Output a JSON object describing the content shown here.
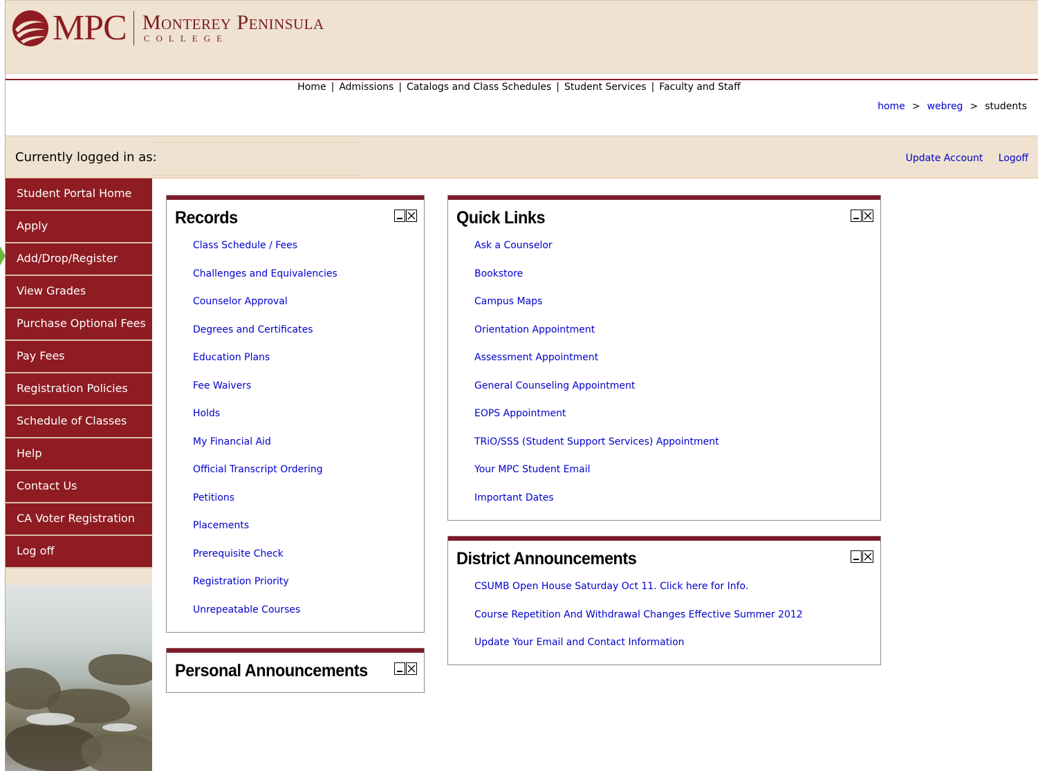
{
  "brand": {
    "mark": "MPC",
    "name": "Monterey Peninsula",
    "subname": "COLLEGE"
  },
  "topnav": [
    "Home",
    "Admissions",
    "Catalogs and Class Schedules",
    "Student Services",
    "Faculty and Staff"
  ],
  "breadcrumb": {
    "home": "home",
    "webreg": "webreg",
    "current": "students",
    "sep": ">"
  },
  "login": {
    "label": "Currently logged in as:",
    "update_account": "Update Account",
    "logoff": "Logoff"
  },
  "sidebar": [
    "Student Portal Home",
    "Apply",
    "Add/Drop/Register",
    "View Grades",
    "Purchase Optional Fees",
    "Pay Fees",
    "Registration Policies",
    "Schedule of Classes",
    "Help",
    "Contact Us",
    "CA Voter Registration",
    "Log off"
  ],
  "records": {
    "title": "Records",
    "links": [
      "Class Schedule / Fees",
      "Challenges and Equivalencies",
      "Counselor Approval",
      "Degrees and Certificates",
      "Education Plans",
      "Fee Waivers",
      "Holds",
      "My Financial Aid",
      "Official Transcript Ordering",
      "Petitions",
      "Placements",
      "Prerequisite Check",
      "Registration Priority",
      "Unrepeatable Courses"
    ]
  },
  "personal": {
    "title": "Personal Announcements"
  },
  "quick_links": {
    "title": "Quick Links",
    "links": [
      "Ask a Counselor",
      "Bookstore",
      "Campus Maps",
      "Orientation Appointment",
      "Assessment Appointment",
      "General Counseling Appointment",
      "EOPS Appointment",
      "TRiO/SSS (Student Support Services) Appointment",
      "Your MPC Student Email",
      "Important Dates"
    ]
  },
  "district": {
    "title": "District Announcements",
    "links": [
      "CSUMB Open House Saturday Oct 11. Click here for Info.",
      "Course Repetition And Withdrawal Changes Effective Summer 2012",
      "Update Your Email and Contact Information"
    ]
  },
  "colors": {
    "brand": "#8e1c22",
    "header_bg": "#efe2d1",
    "link": "#0000cc",
    "panel_bar": "#7a1c2a"
  }
}
